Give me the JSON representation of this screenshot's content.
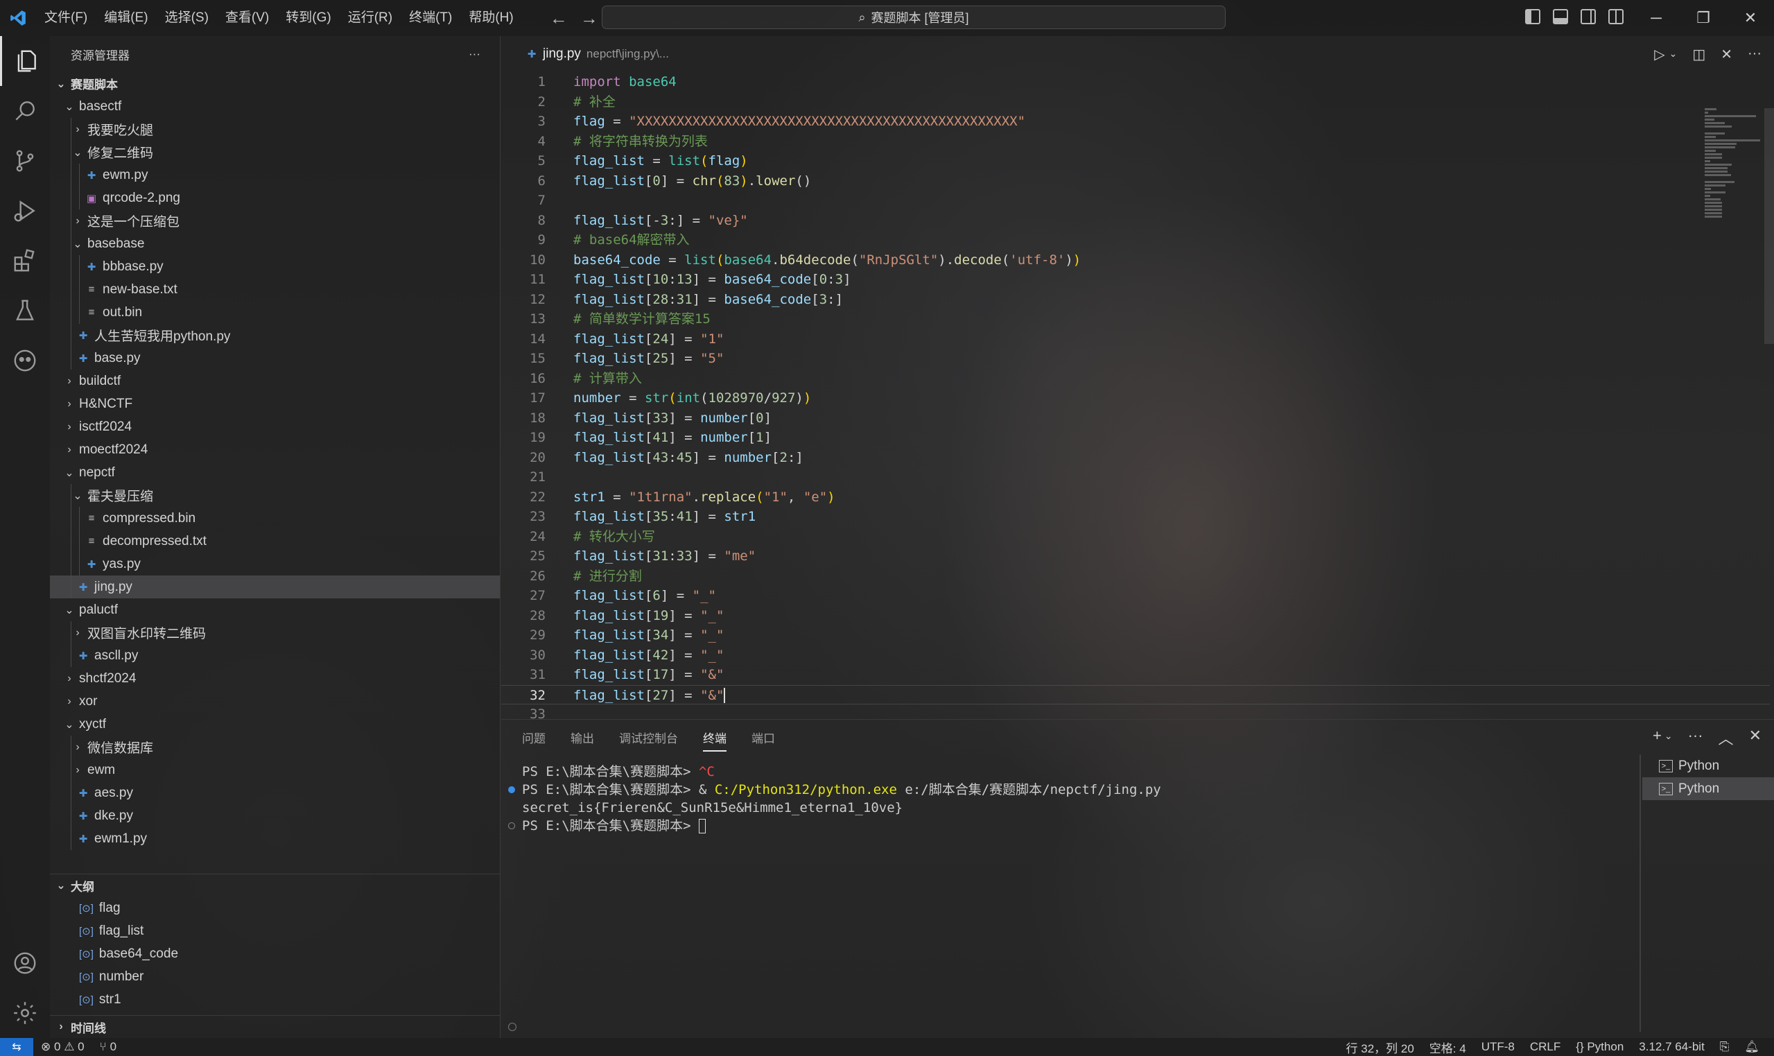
{
  "window": {
    "command_center": "赛题脚本 [管理员]"
  },
  "menu": [
    "文件(F)",
    "编辑(E)",
    "选择(S)",
    "查看(V)",
    "转到(G)",
    "运行(R)",
    "终端(T)",
    "帮助(H)"
  ],
  "sidebar": {
    "title": "资源管理器",
    "more": "···",
    "workspace": "赛题脚本",
    "tree": [
      {
        "label": "basectf",
        "depth": 1,
        "type": "folder",
        "open": true
      },
      {
        "label": "我要吃火腿",
        "depth": 2,
        "type": "folder",
        "open": false
      },
      {
        "label": "修复二维码",
        "depth": 2,
        "type": "folder",
        "open": true
      },
      {
        "label": "ewm.py",
        "depth": 3,
        "type": "py"
      },
      {
        "label": "qrcode-2.png",
        "depth": 3,
        "type": "img"
      },
      {
        "label": "这是一个压缩包",
        "depth": 2,
        "type": "folder",
        "open": false
      },
      {
        "label": "basebase",
        "depth": 2,
        "type": "folder",
        "open": true
      },
      {
        "label": "bbbase.py",
        "depth": 3,
        "type": "py"
      },
      {
        "label": "new-base.txt",
        "depth": 3,
        "type": "txt"
      },
      {
        "label": "out.bin",
        "depth": 3,
        "type": "txt"
      },
      {
        "label": "人生苦短我用python.py",
        "depth": 2,
        "type": "py"
      },
      {
        "label": "base.py",
        "depth": 2,
        "type": "py"
      },
      {
        "label": "buildctf",
        "depth": 1,
        "type": "folder",
        "open": false
      },
      {
        "label": "H&NCTF",
        "depth": 1,
        "type": "folder",
        "open": false
      },
      {
        "label": "isctf2024",
        "depth": 1,
        "type": "folder",
        "open": false
      },
      {
        "label": "moectf2024",
        "depth": 1,
        "type": "folder",
        "open": false
      },
      {
        "label": "nepctf",
        "depth": 1,
        "type": "folder",
        "open": true
      },
      {
        "label": "霍夫曼压缩",
        "depth": 2,
        "type": "folder",
        "open": true
      },
      {
        "label": "compressed.bin",
        "depth": 3,
        "type": "txt"
      },
      {
        "label": "decompressed.txt",
        "depth": 3,
        "type": "txt"
      },
      {
        "label": "yas.py",
        "depth": 3,
        "type": "py"
      },
      {
        "label": "jing.py",
        "depth": 2,
        "type": "py",
        "selected": true
      },
      {
        "label": "paluctf",
        "depth": 1,
        "type": "folder",
        "open": true
      },
      {
        "label": "双图盲水印转二维码",
        "depth": 2,
        "type": "folder",
        "open": false
      },
      {
        "label": "ascll.py",
        "depth": 2,
        "type": "py"
      },
      {
        "label": "shctf2024",
        "depth": 1,
        "type": "folder",
        "open": false
      },
      {
        "label": "xor",
        "depth": 1,
        "type": "folder",
        "open": false
      },
      {
        "label": "xyctf",
        "depth": 1,
        "type": "folder",
        "open": true
      },
      {
        "label": "微信数据库",
        "depth": 2,
        "type": "folder",
        "open": false
      },
      {
        "label": "ewm",
        "depth": 2,
        "type": "folder",
        "open": false
      },
      {
        "label": "aes.py",
        "depth": 2,
        "type": "py"
      },
      {
        "label": "dke.py",
        "depth": 2,
        "type": "py"
      },
      {
        "label": "ewm1.py",
        "depth": 2,
        "type": "py"
      }
    ],
    "outline_title": "大纲",
    "outline": [
      "flag",
      "flag_list",
      "base64_code",
      "number",
      "str1"
    ],
    "timeline_title": "时间线"
  },
  "editor": {
    "tab": {
      "name": "jing.py",
      "description": "nepctf\\jing.py\\..."
    },
    "lines": [
      [
        [
          "k",
          "import"
        ],
        [
          "t",
          " "
        ],
        [
          "b",
          "base64"
        ]
      ],
      [
        [
          "c",
          "# 补全"
        ]
      ],
      [
        [
          "v",
          "flag"
        ],
        [
          "t",
          " = "
        ],
        [
          "s",
          "\"XXXXXXXXXXXXXXXXXXXXXXXXXXXXXXXXXXXXXXXXXXXXXXXX\""
        ]
      ],
      [
        [
          "c",
          "# 将字符串转换为列表"
        ]
      ],
      [
        [
          "v",
          "flag_list"
        ],
        [
          "t",
          " = "
        ],
        [
          "b",
          "list"
        ],
        [
          "p",
          "("
        ],
        [
          "v",
          "flag"
        ],
        [
          "p",
          ")"
        ]
      ],
      [
        [
          "v",
          "flag_list"
        ],
        [
          "t",
          "["
        ],
        [
          "n",
          "0"
        ],
        [
          "t",
          "] = "
        ],
        [
          "f",
          "chr"
        ],
        [
          "p",
          "("
        ],
        [
          "n",
          "83"
        ],
        [
          "p",
          ")"
        ],
        [
          "t",
          "."
        ],
        [
          "f",
          "lower"
        ],
        [
          "t",
          "()"
        ]
      ],
      [],
      [
        [
          "v",
          "flag_list"
        ],
        [
          "t",
          "[-"
        ],
        [
          "n",
          "3"
        ],
        [
          "t",
          ":] = "
        ],
        [
          "s",
          "\"ve}\""
        ]
      ],
      [
        [
          "c",
          "# base64解密带入"
        ]
      ],
      [
        [
          "v",
          "base64_code"
        ],
        [
          "t",
          " = "
        ],
        [
          "b",
          "list"
        ],
        [
          "p",
          "("
        ],
        [
          "b",
          "base64"
        ],
        [
          "t",
          "."
        ],
        [
          "f",
          "b64decode"
        ],
        [
          "t",
          "("
        ],
        [
          "s",
          "\"RnJpSGlt\""
        ],
        [
          "t",
          ")."
        ],
        [
          "f",
          "decode"
        ],
        [
          "t",
          "("
        ],
        [
          "s",
          "'utf-8'"
        ],
        [
          "t",
          ")"
        ],
        [
          "p",
          ")"
        ]
      ],
      [
        [
          "v",
          "flag_list"
        ],
        [
          "t",
          "["
        ],
        [
          "n",
          "10"
        ],
        [
          "t",
          ":"
        ],
        [
          "n",
          "13"
        ],
        [
          "t",
          "] = "
        ],
        [
          "v",
          "base64_code"
        ],
        [
          "t",
          "["
        ],
        [
          "n",
          "0"
        ],
        [
          "t",
          ":"
        ],
        [
          "n",
          "3"
        ],
        [
          "t",
          "]"
        ]
      ],
      [
        [
          "v",
          "flag_list"
        ],
        [
          "t",
          "["
        ],
        [
          "n",
          "28"
        ],
        [
          "t",
          ":"
        ],
        [
          "n",
          "31"
        ],
        [
          "t",
          "] = "
        ],
        [
          "v",
          "base64_code"
        ],
        [
          "t",
          "["
        ],
        [
          "n",
          "3"
        ],
        [
          "t",
          ":]"
        ]
      ],
      [
        [
          "c",
          "# 简单数学计算答案15"
        ]
      ],
      [
        [
          "v",
          "flag_list"
        ],
        [
          "t",
          "["
        ],
        [
          "n",
          "24"
        ],
        [
          "t",
          "] = "
        ],
        [
          "s",
          "\"1\""
        ]
      ],
      [
        [
          "v",
          "flag_list"
        ],
        [
          "t",
          "["
        ],
        [
          "n",
          "25"
        ],
        [
          "t",
          "] = "
        ],
        [
          "s",
          "\"5\""
        ]
      ],
      [
        [
          "c",
          "# 计算带入"
        ]
      ],
      [
        [
          "v",
          "number"
        ],
        [
          "t",
          " = "
        ],
        [
          "b",
          "str"
        ],
        [
          "p",
          "("
        ],
        [
          "b",
          "int"
        ],
        [
          "t",
          "("
        ],
        [
          "n",
          "1028970"
        ],
        [
          "t",
          "/"
        ],
        [
          "n",
          "927"
        ],
        [
          "t",
          ")"
        ],
        [
          "p",
          ")"
        ]
      ],
      [
        [
          "v",
          "flag_list"
        ],
        [
          "t",
          "["
        ],
        [
          "n",
          "33"
        ],
        [
          "t",
          "] = "
        ],
        [
          "v",
          "number"
        ],
        [
          "t",
          "["
        ],
        [
          "n",
          "0"
        ],
        [
          "t",
          "]"
        ]
      ],
      [
        [
          "v",
          "flag_list"
        ],
        [
          "t",
          "["
        ],
        [
          "n",
          "41"
        ],
        [
          "t",
          "] = "
        ],
        [
          "v",
          "number"
        ],
        [
          "t",
          "["
        ],
        [
          "n",
          "1"
        ],
        [
          "t",
          "]"
        ]
      ],
      [
        [
          "v",
          "flag_list"
        ],
        [
          "t",
          "["
        ],
        [
          "n",
          "43"
        ],
        [
          "t",
          ":"
        ],
        [
          "n",
          "45"
        ],
        [
          "t",
          "] = "
        ],
        [
          "v",
          "number"
        ],
        [
          "t",
          "["
        ],
        [
          "n",
          "2"
        ],
        [
          "t",
          ":]"
        ]
      ],
      [],
      [
        [
          "v",
          "str1"
        ],
        [
          "t",
          " = "
        ],
        [
          "s",
          "\"1t1rna\""
        ],
        [
          "t",
          "."
        ],
        [
          "f",
          "replace"
        ],
        [
          "p",
          "("
        ],
        [
          "s",
          "\"1\""
        ],
        [
          "t",
          ", "
        ],
        [
          "s",
          "\"e\""
        ],
        [
          "p",
          ")"
        ]
      ],
      [
        [
          "v",
          "flag_list"
        ],
        [
          "t",
          "["
        ],
        [
          "n",
          "35"
        ],
        [
          "t",
          ":"
        ],
        [
          "n",
          "41"
        ],
        [
          "t",
          "] = "
        ],
        [
          "v",
          "str1"
        ]
      ],
      [
        [
          "c",
          "# 转化大小写"
        ]
      ],
      [
        [
          "v",
          "flag_list"
        ],
        [
          "t",
          "["
        ],
        [
          "n",
          "31"
        ],
        [
          "t",
          ":"
        ],
        [
          "n",
          "33"
        ],
        [
          "t",
          "] = "
        ],
        [
          "s",
          "\"me\""
        ]
      ],
      [
        [
          "c",
          "# 进行分割"
        ]
      ],
      [
        [
          "v",
          "flag_list"
        ],
        [
          "t",
          "["
        ],
        [
          "n",
          "6"
        ],
        [
          "t",
          "] = "
        ],
        [
          "s",
          "\"_\""
        ]
      ],
      [
        [
          "v",
          "flag_list"
        ],
        [
          "t",
          "["
        ],
        [
          "n",
          "19"
        ],
        [
          "t",
          "] = "
        ],
        [
          "s",
          "\"_\""
        ]
      ],
      [
        [
          "v",
          "flag_list"
        ],
        [
          "t",
          "["
        ],
        [
          "n",
          "34"
        ],
        [
          "t",
          "] = "
        ],
        [
          "s",
          "\"_\""
        ]
      ],
      [
        [
          "v",
          "flag_list"
        ],
        [
          "t",
          "["
        ],
        [
          "n",
          "42"
        ],
        [
          "t",
          "] = "
        ],
        [
          "s",
          "\"_\""
        ]
      ],
      [
        [
          "v",
          "flag_list"
        ],
        [
          "t",
          "["
        ],
        [
          "n",
          "17"
        ],
        [
          "t",
          "] = "
        ],
        [
          "s",
          "\"&\""
        ]
      ],
      [
        [
          "v",
          "flag_list"
        ],
        [
          "t",
          "["
        ],
        [
          "n",
          "27"
        ],
        [
          "t",
          "] = "
        ],
        [
          "s",
          "\"&\""
        ]
      ],
      []
    ],
    "current_line": 32
  },
  "panel": {
    "tabs": [
      "问题",
      "输出",
      "调试控制台",
      "终端",
      "端口"
    ],
    "active_tab": "终端",
    "terminal": [
      {
        "dot": "none",
        "segs": [
          [
            "t",
            "PS E:\\脚本合集\\赛题脚本> "
          ],
          [
            "r",
            "^C"
          ]
        ]
      },
      {
        "dot": "blue",
        "segs": [
          [
            "t",
            "PS E:\\脚本合集\\赛题脚本> & "
          ],
          [
            "y",
            "C:/Python312/python.exe"
          ],
          [
            "t",
            " e:/脚本合集/赛题脚本/nepctf/jing.py"
          ]
        ]
      },
      {
        "dot": "none",
        "segs": [
          [
            "t",
            "secret_is{Frieren&C_SunR15e&Himme1_eterna1_10ve}"
          ]
        ]
      },
      {
        "dot": "hollow",
        "segs": [
          [
            "t",
            "PS E:\\脚本合集\\赛题脚本> "
          ]
        ],
        "cursor": true
      }
    ],
    "terminals": [
      "Python",
      "Python"
    ]
  },
  "statusbar": {
    "errors": "0",
    "warnings": "0",
    "ports": "0",
    "position": "行 32，列 20",
    "spaces": "空格: 4",
    "encoding": "UTF-8",
    "eol": "CRLF",
    "language": "{} Python",
    "interpreter": "3.12.7 64-bit"
  },
  "colors": {
    "accent": "#1b6ac9",
    "python_icon": "#4f8fcf"
  }
}
